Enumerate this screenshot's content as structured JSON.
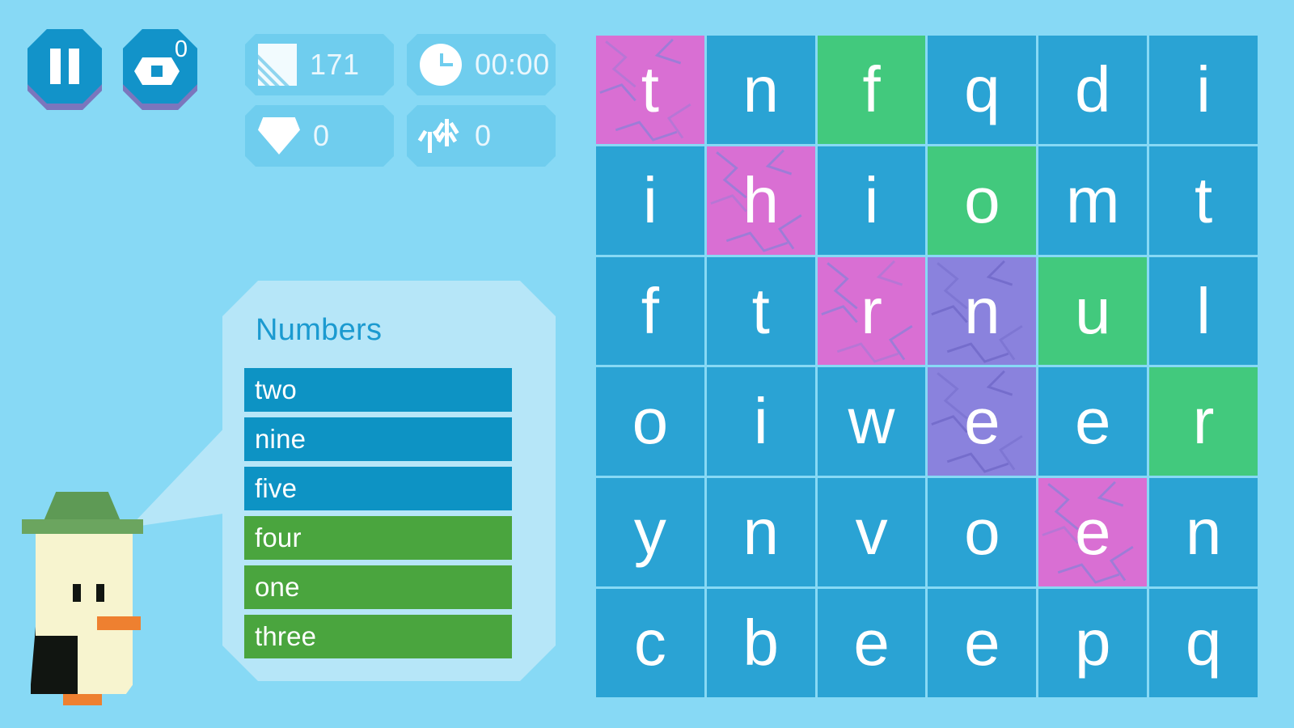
{
  "background_color": "#87d9f5",
  "controls": [
    {
      "name": "pause-button",
      "icon": "pause-icon",
      "label": ""
    },
    {
      "name": "hint-button",
      "icon": "eye-icon",
      "badge": "0"
    }
  ],
  "hud": {
    "stats": [
      {
        "icon": "ice-tile-icon",
        "name": "ice-stat",
        "value": "171"
      },
      {
        "icon": "clock-icon",
        "name": "timer-stat",
        "value": "00:00"
      },
      {
        "icon": "gem-icon",
        "name": "gem-stat",
        "value": "0"
      },
      {
        "icon": "sprout-icon",
        "name": "plant-stat",
        "value": "0"
      }
    ]
  },
  "word_panel": {
    "title": "Numbers",
    "words": [
      {
        "text": "two",
        "found": false
      },
      {
        "text": "nine",
        "found": false
      },
      {
        "text": "five",
        "found": false
      },
      {
        "text": "four",
        "found": true
      },
      {
        "text": "one",
        "found": true
      },
      {
        "text": "three",
        "found": true
      }
    ]
  },
  "character": {
    "name": "penguin-avatar",
    "hat_color": "#6ba55f",
    "body_color": "#111511",
    "face_color": "#f7f4cf",
    "beak_color": "#ee8030"
  },
  "colors": {
    "cell_blue": "#2aa3d4",
    "cell_green": "#42c97d",
    "cell_pink": "#d96fd3",
    "cell_purple": "#8a82dd",
    "word_pending": "#0d93c4",
    "word_found": "#4aa53e",
    "panel": "#b6e6f8",
    "pill": "#6fcdee",
    "button": "#1293c9",
    "button_shadow": "#7b76bd"
  },
  "grid": {
    "rows": 6,
    "cols": 6,
    "cells": [
      {
        "letter": "t",
        "state": "pink"
      },
      {
        "letter": "n",
        "state": "blue"
      },
      {
        "letter": "f",
        "state": "green"
      },
      {
        "letter": "q",
        "state": "blue"
      },
      {
        "letter": "d",
        "state": "blue"
      },
      {
        "letter": "i",
        "state": "blue"
      },
      {
        "letter": "i",
        "state": "blue"
      },
      {
        "letter": "h",
        "state": "pink"
      },
      {
        "letter": "i",
        "state": "blue"
      },
      {
        "letter": "o",
        "state": "green"
      },
      {
        "letter": "m",
        "state": "blue"
      },
      {
        "letter": "t",
        "state": "blue"
      },
      {
        "letter": "f",
        "state": "blue"
      },
      {
        "letter": "t",
        "state": "blue"
      },
      {
        "letter": "r",
        "state": "pink"
      },
      {
        "letter": "n",
        "state": "purple"
      },
      {
        "letter": "u",
        "state": "green"
      },
      {
        "letter": "l",
        "state": "blue"
      },
      {
        "letter": "o",
        "state": "blue"
      },
      {
        "letter": "i",
        "state": "blue"
      },
      {
        "letter": "w",
        "state": "blue"
      },
      {
        "letter": "e",
        "state": "purple"
      },
      {
        "letter": "e",
        "state": "blue"
      },
      {
        "letter": "r",
        "state": "green"
      },
      {
        "letter": "y",
        "state": "blue"
      },
      {
        "letter": "n",
        "state": "blue"
      },
      {
        "letter": "v",
        "state": "blue"
      },
      {
        "letter": "o",
        "state": "blue"
      },
      {
        "letter": "e",
        "state": "pink"
      },
      {
        "letter": "n",
        "state": "blue"
      },
      {
        "letter": "c",
        "state": "blue"
      },
      {
        "letter": "b",
        "state": "blue"
      },
      {
        "letter": "e",
        "state": "blue"
      },
      {
        "letter": "e",
        "state": "blue"
      },
      {
        "letter": "p",
        "state": "blue"
      },
      {
        "letter": "q",
        "state": "blue"
      }
    ]
  }
}
